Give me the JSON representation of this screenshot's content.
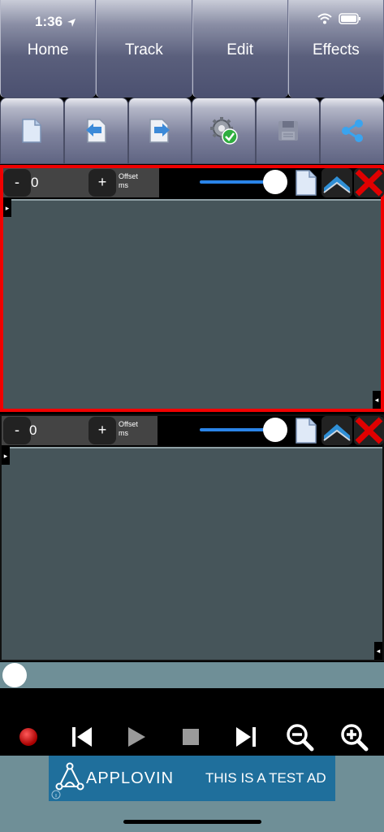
{
  "status": {
    "time": "1:36"
  },
  "nav": {
    "tabs": [
      {
        "label": "Home"
      },
      {
        "label": "Track"
      },
      {
        "label": "Edit"
      },
      {
        "label": "Effects"
      }
    ]
  },
  "toolbar": {
    "icons": [
      "new-file-icon",
      "import-icon",
      "export-icon",
      "settings-check-icon",
      "save-icon",
      "share-icon"
    ]
  },
  "tracks": [
    {
      "offset_value": "0",
      "offset_label_1": "Offset",
      "offset_label_2": "ms",
      "minus": "-",
      "plus": "+",
      "selected": true,
      "border_color": "#f00000"
    },
    {
      "offset_value": "0",
      "offset_label_1": "Offset",
      "offset_label_2": "ms",
      "minus": "-",
      "plus": "+",
      "selected": false
    }
  ],
  "colors": {
    "accent": "#2a84e8",
    "waveform_bg": "#46555a",
    "timeline_bg": "#6f8f97",
    "delete": "#e00000"
  },
  "transport": {
    "icons": [
      "record-icon",
      "skip-back-icon",
      "play-icon",
      "stop-icon",
      "skip-forward-icon",
      "zoom-out-icon",
      "zoom-in-icon"
    ]
  },
  "ad": {
    "brand": "APPLOVIN",
    "text": "THIS IS A TEST AD"
  }
}
